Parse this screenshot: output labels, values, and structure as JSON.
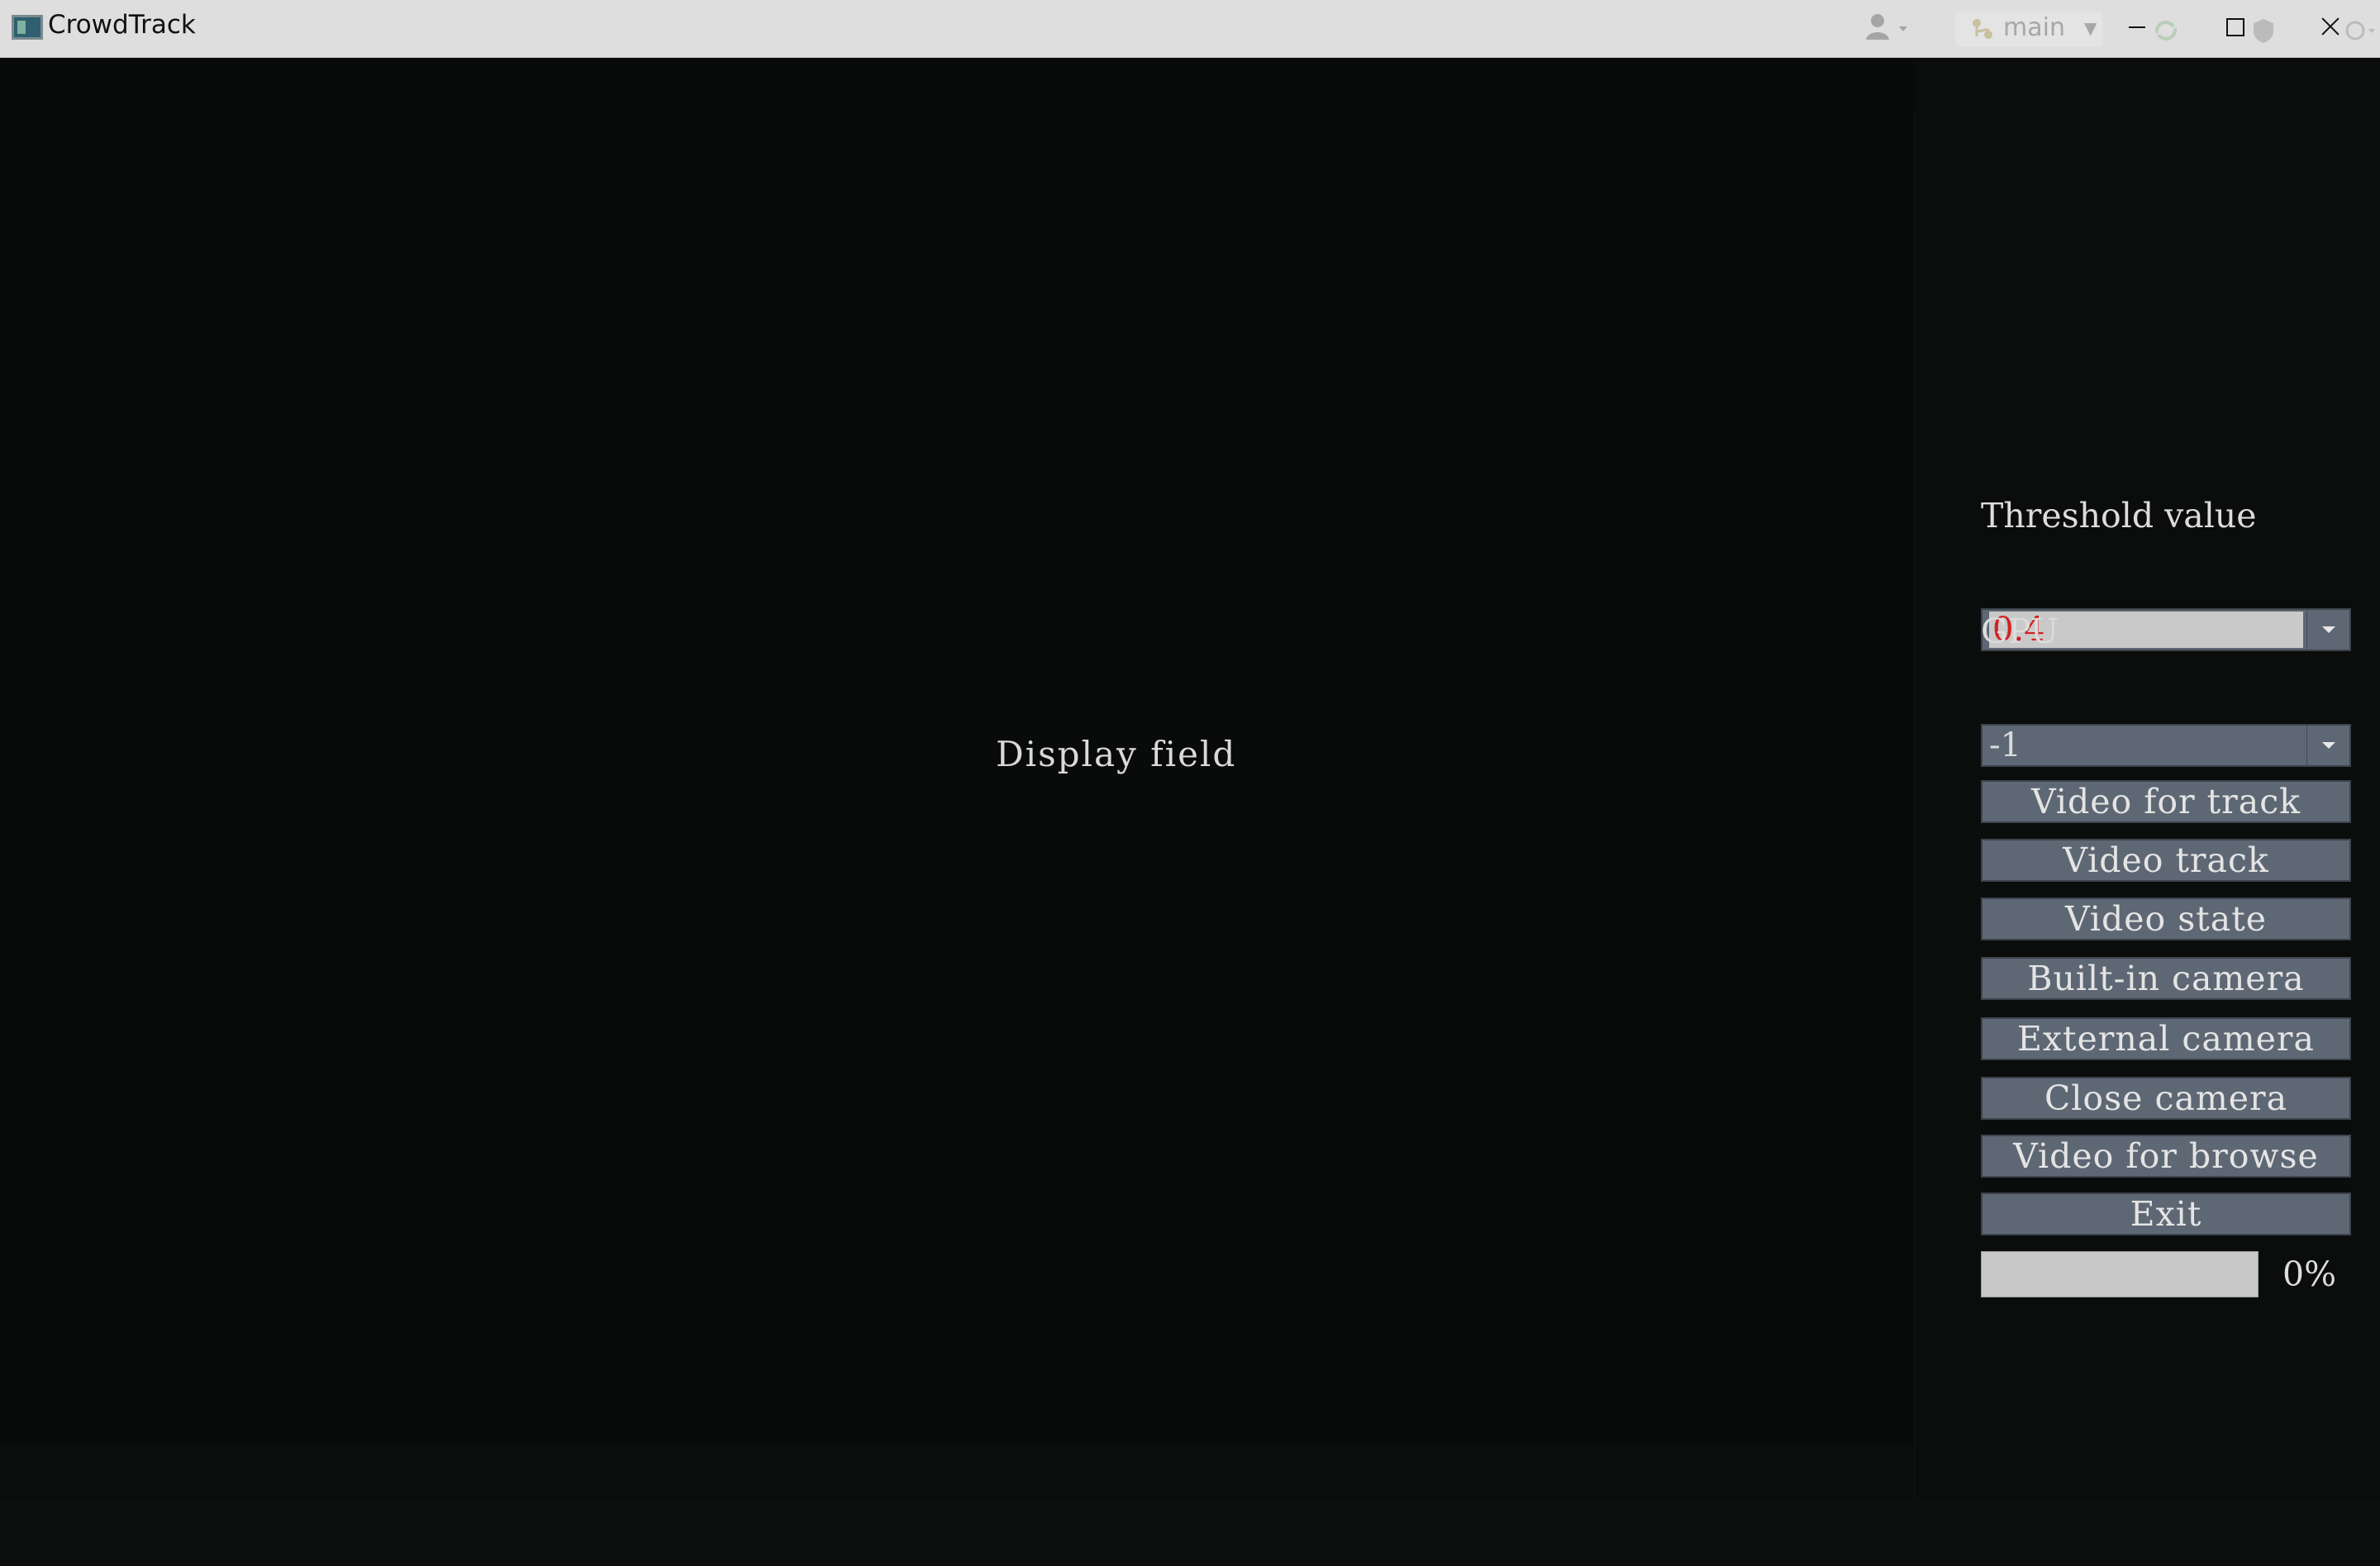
{
  "window": {
    "title": "CrowdTrack",
    "branch": "main",
    "icons": {
      "app": "app-icon",
      "user": "user-dropdown-icon",
      "branch": "branch-icon",
      "minimize": "minimize-icon",
      "maximize": "maximize-icon",
      "close": "close-icon"
    }
  },
  "display": {
    "label": "Display field"
  },
  "controls": {
    "threshold": {
      "label": "Threshold value",
      "value": "0.4"
    },
    "gpu": {
      "label": "GPU",
      "value": "-1"
    },
    "buttons": {
      "video_for_track": "Video for track",
      "video_track": "Video track",
      "video_state": "Video state",
      "builtin_camera": "Built-in camera",
      "external_camera": "External camera",
      "close_camera": "Close camera",
      "video_for_browse": "Video for browse",
      "exit": "Exit"
    },
    "progress": {
      "value": 0,
      "text": "0%"
    }
  },
  "colors": {
    "background": "#0a0b0b",
    "button": "#5e6874",
    "threshold_text": "#d21f1f",
    "titlebar": "#dedede"
  }
}
